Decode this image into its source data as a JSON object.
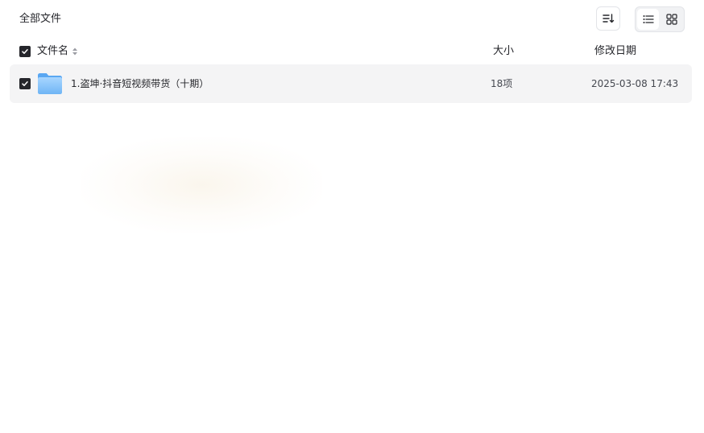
{
  "breadcrumb": {
    "title": "全部文件"
  },
  "toolbar": {
    "sort_icon": "sort-icon",
    "view_list_icon": "list-view-icon",
    "view_grid_icon": "grid-view-icon",
    "active_view": "list"
  },
  "table": {
    "columns": {
      "name": "文件名",
      "size": "大小",
      "modified": "修改日期"
    },
    "rows": [
      {
        "icon": "folder-icon",
        "name": "1.盗坤·抖音短视频带货（十期）",
        "size": "18项",
        "modified": "2025-03-08 17:43",
        "checked": true
      }
    ]
  },
  "colors": {
    "text": "#25262b",
    "row_hover": "#f4f4f5",
    "checkbox": "#25262b",
    "folder_light": "#8fc9fb",
    "folder_dark": "#5aa7f2"
  }
}
